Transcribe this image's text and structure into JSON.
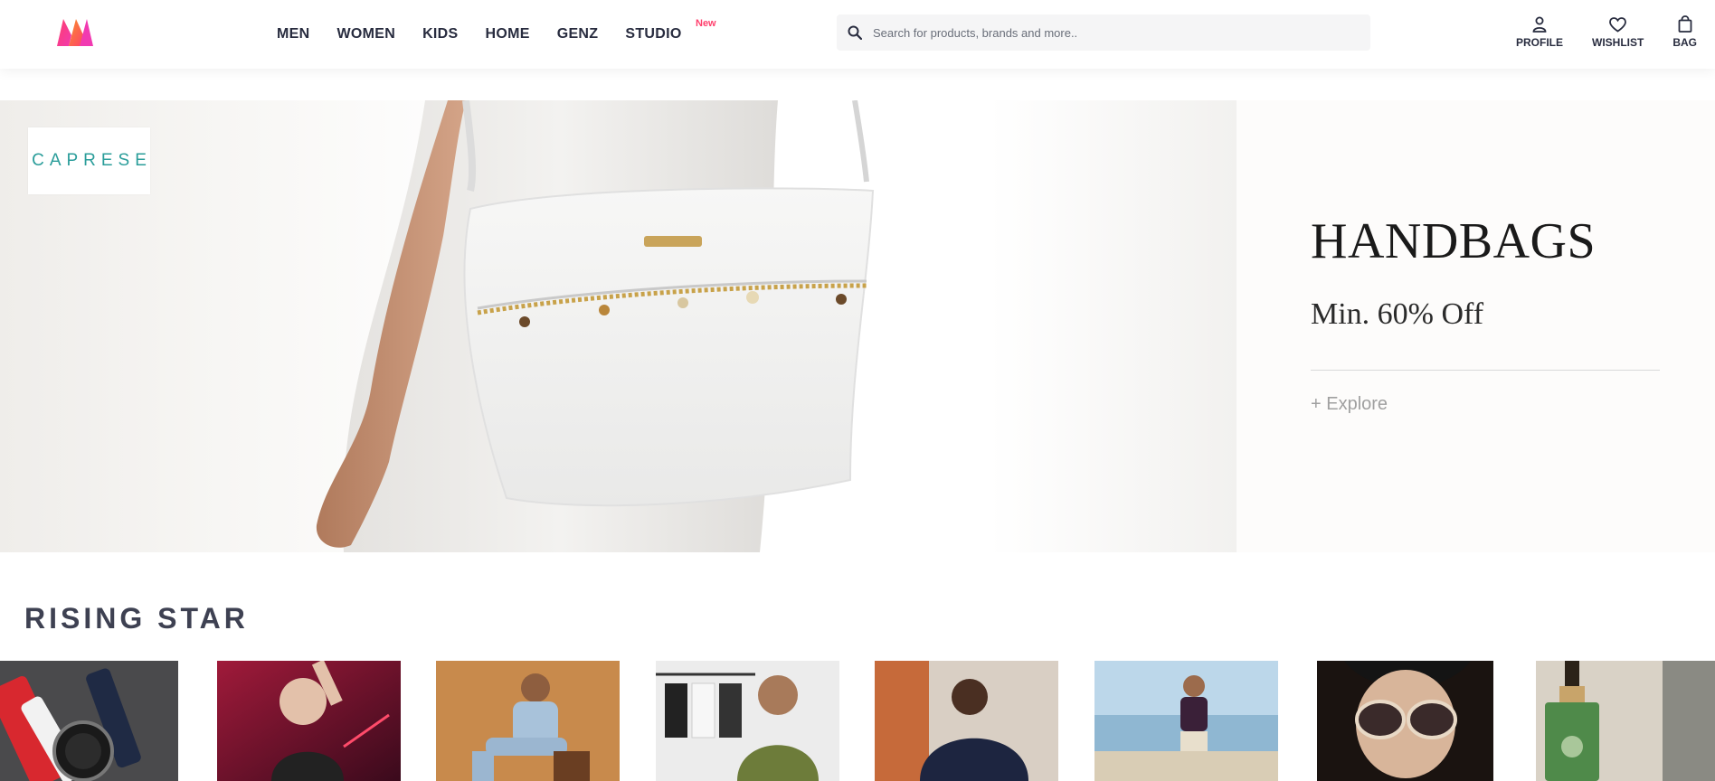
{
  "header": {
    "nav": [
      {
        "label": "MEN"
      },
      {
        "label": "WOMEN"
      },
      {
        "label": "KIDS"
      },
      {
        "label": "HOME"
      },
      {
        "label": "GENZ"
      },
      {
        "label": "STUDIO",
        "badge": "New"
      }
    ],
    "search": {
      "placeholder": "Search for products, brands and more.."
    },
    "actions": {
      "profile": "PROFILE",
      "wishlist": "WISHLIST",
      "bag": "BAG"
    },
    "colors": {
      "brand_pink": "#ff3f6c",
      "brand_orange": "#f98f2b"
    }
  },
  "hero": {
    "brand": "CAPRESE",
    "title": "HANDBAGS",
    "subtitle": "Min. 60% Off",
    "cta": "+ Explore"
  },
  "section": {
    "title": "RISING STAR"
  },
  "tiles": [
    {
      "name": "watch-straps"
    },
    {
      "name": "male-model-neon"
    },
    {
      "name": "denim-model-chair"
    },
    {
      "name": "tshirt-model-rack"
    },
    {
      "name": "hoodie-model"
    },
    {
      "name": "polo-beach"
    },
    {
      "name": "sunglasses-model"
    },
    {
      "name": "serum-bottle"
    }
  ]
}
